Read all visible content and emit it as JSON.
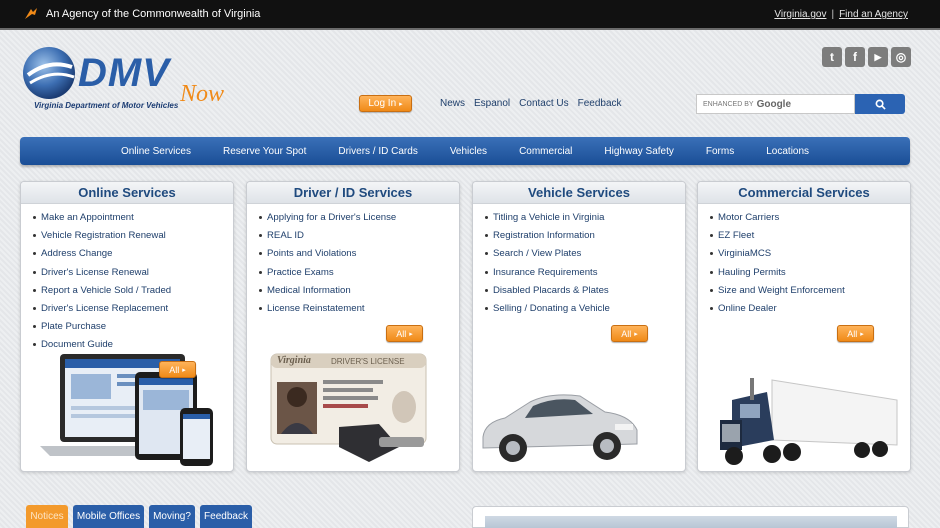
{
  "agency_bar": {
    "text": "An Agency of the Commonwealth of Virginia",
    "links": [
      "Virginia.gov",
      "Find an Agency"
    ]
  },
  "logo": {
    "brand": "DMV",
    "tagline": "Now",
    "subtitle": "Virginia Department of Motor Vehicles"
  },
  "social": [
    {
      "icon": "twitter-icon",
      "glyph": "t"
    },
    {
      "icon": "facebook-icon",
      "glyph": "f"
    },
    {
      "icon": "youtube-icon",
      "glyph": "▶"
    },
    {
      "icon": "instagram-icon",
      "glyph": "◎"
    }
  ],
  "header": {
    "login_label": "Log In",
    "links": [
      "News",
      "Espanol",
      "Contact Us",
      "Feedback"
    ]
  },
  "search": {
    "enhanced_label": "ENHANCED BY",
    "brand": "Google"
  },
  "nav": [
    "Online Services",
    "Reserve Your Spot",
    "Drivers / ID Cards",
    "Vehicles",
    "Commercial",
    "Highway Safety",
    "Forms",
    "Locations"
  ],
  "panels": [
    {
      "title": "Online Services",
      "items": [
        "Make an Appointment",
        "Vehicle Registration Renewal",
        "Address Change",
        "Driver's License Renewal",
        "Report a Vehicle Sold / Traded",
        "Driver's License Replacement",
        "Plate Purchase",
        "Document Guide"
      ],
      "all_label": "All"
    },
    {
      "title": "Driver / ID Services",
      "items": [
        "Applying for a Driver's License",
        "REAL ID",
        "Points and Violations",
        "Practice Exams",
        "Medical Information",
        "License Reinstatement"
      ],
      "all_label": "All"
    },
    {
      "title": "Vehicle Services",
      "items": [
        "Titling a Vehicle in Virginia",
        "Registration Information",
        "Search / View Plates",
        "Insurance Requirements",
        "Disabled Placards & Plates",
        "Selling / Donating a Vehicle"
      ],
      "all_label": "All"
    },
    {
      "title": "Commercial Services",
      "items": [
        "Motor Carriers",
        "EZ Fleet",
        "VirginiaMCS",
        "Hauling Permits",
        "Size and Weight Enforcement",
        "Online Dealer"
      ],
      "all_label": "All"
    }
  ],
  "license_art": {
    "state": "Virginia",
    "label": "DRIVER'S LICENSE"
  },
  "bottom_tabs": [
    "Notices",
    "Mobile Offices",
    "Moving?",
    "Feedback"
  ],
  "colors": {
    "navy": "#1f4a7e",
    "orange": "#f08a18",
    "nav_blue": "#2a5ea8"
  }
}
